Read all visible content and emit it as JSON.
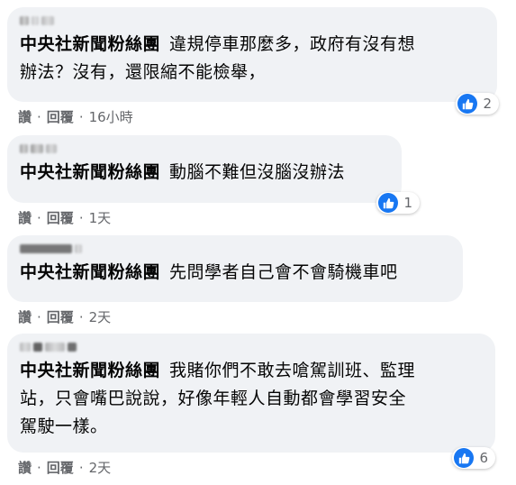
{
  "comments": [
    {
      "page_name": "中央社新聞粉絲團",
      "line1": "違規停車那麼多，政府有沒有想",
      "line2": "辦法？沒有，還限縮不能檢舉，",
      "actions": {
        "like": "讚",
        "reply": "回覆",
        "time": "16小時"
      },
      "likes": "2"
    },
    {
      "page_name": "中央社新聞粉絲團",
      "line1": "動腦不難但沒腦沒辦法",
      "actions": {
        "like": "讚",
        "reply": "回覆",
        "time": "1天"
      },
      "likes": "1"
    },
    {
      "page_name": "中央社新聞粉絲團",
      "line1": "先問學者自己會不會騎機車吧",
      "actions": {
        "like": "讚",
        "reply": "回覆",
        "time": "2天"
      }
    },
    {
      "page_name": "中央社新聞粉絲團",
      "line1": "我賭你們不敢去嗆駕訓班、監理",
      "line2": "站，只會嘴巴說說，好像年輕人自動都會學習安全",
      "line3": "駕駛一樣。",
      "actions": {
        "like": "讚",
        "reply": "回覆",
        "time": "2天"
      },
      "likes": "6"
    }
  ],
  "separator": "·",
  "colors": {
    "bubble": "#f0f2f5",
    "like_blue": "#1877f2",
    "meta_gray": "#65676b"
  }
}
